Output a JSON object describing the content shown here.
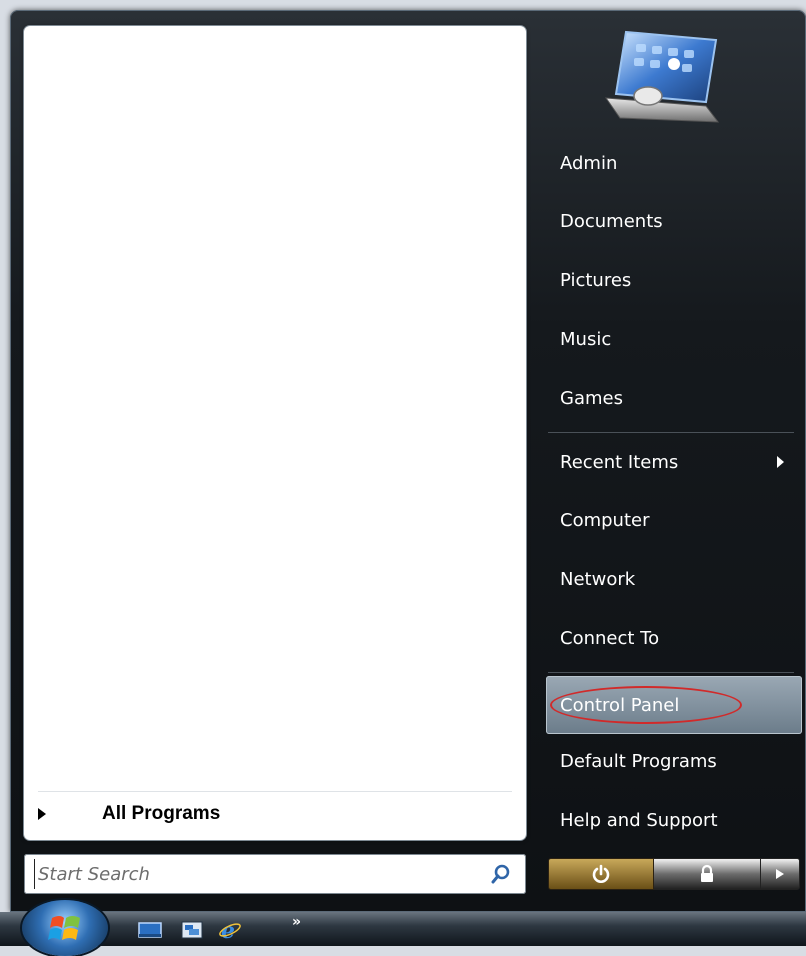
{
  "left_pane": {
    "all_programs_label": "All Programs"
  },
  "search": {
    "placeholder": "Start Search"
  },
  "right_pane": {
    "items": [
      {
        "label": "Admin"
      },
      {
        "label": "Documents"
      },
      {
        "label": "Pictures"
      },
      {
        "label": "Music"
      },
      {
        "label": "Games"
      },
      {
        "label": "Recent Items"
      },
      {
        "label": "Computer"
      },
      {
        "label": "Network"
      },
      {
        "label": "Connect To"
      },
      {
        "label": "Control Panel"
      },
      {
        "label": "Default Programs"
      },
      {
        "label": "Help and Support"
      }
    ],
    "highlighted_item": "Control Panel"
  },
  "power": {
    "power_icon": "power-icon",
    "lock_icon": "lock-icon",
    "more_icon": "arrow-right-icon"
  },
  "taskbar": {
    "quick_launch": [
      "show-desktop-icon",
      "switch-windows-icon",
      "internet-explorer-icon"
    ],
    "overflow_label": "»"
  },
  "colors": {
    "highlight_circle": "#d12a2a",
    "highlight_bg": "#8c9ba8",
    "menu_bg": "#15191d"
  }
}
